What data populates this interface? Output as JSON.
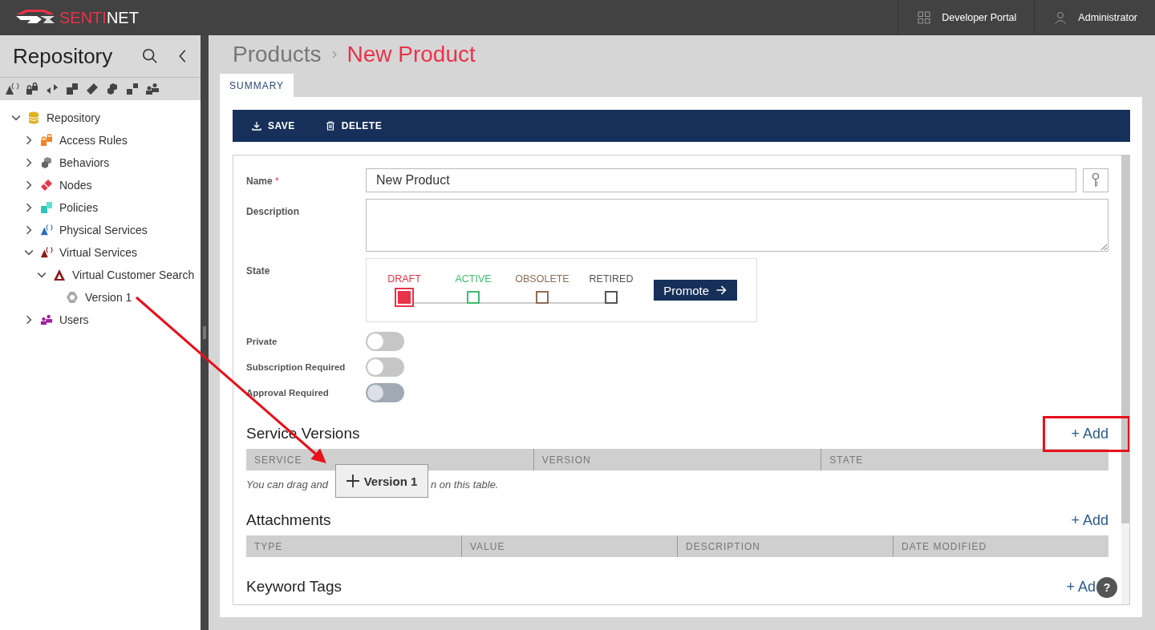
{
  "header": {
    "logo_first": "SENTI",
    "logo_second": "NET",
    "links": [
      {
        "kind": "grid",
        "label": "Developer Portal"
      },
      {
        "kind": "user",
        "label": "Administrator"
      }
    ]
  },
  "sidebar": {
    "title": "Repository",
    "tree": [
      {
        "label": "Repository",
        "kind": "database",
        "expanded": true,
        "children": [
          {
            "label": "Access Rules",
            "kind": "lock",
            "expanded": false
          },
          {
            "label": "Behaviors",
            "kind": "hexagons",
            "expanded": false
          },
          {
            "label": "Nodes",
            "kind": "diamond",
            "expanded": false
          },
          {
            "label": "Policies",
            "kind": "squares",
            "expanded": false
          },
          {
            "label": "Physical Services",
            "kind": "physical",
            "expanded": false
          },
          {
            "label": "Virtual Services",
            "kind": "virtual",
            "expanded": true,
            "children": [
              {
                "label": "Virtual Customer Search",
                "kind": "triangle",
                "expanded": true,
                "children": [
                  {
                    "label": "Version 1",
                    "kind": "gear"
                  }
                ]
              }
            ]
          },
          {
            "label": "Users",
            "kind": "people",
            "expanded": false
          }
        ]
      }
    ]
  },
  "breadcrumb": [
    {
      "label": "Products",
      "selected": false
    },
    {
      "label": "New Product",
      "selected": true
    }
  ],
  "tabs": [
    {
      "label": "SUMMARY",
      "selected": true
    }
  ],
  "toolbar": [
    {
      "kind": "save",
      "label": "SAVE"
    },
    {
      "kind": "delete",
      "label": "DELETE"
    }
  ],
  "form": {
    "name_label": "Name",
    "required_mark": "*",
    "name_value": "New Product",
    "description_label": "Description",
    "state_label": "State",
    "states": [
      {
        "label": "DRAFT",
        "color": "#e8334a",
        "selected": true
      },
      {
        "label": "ACTIVE",
        "color": "#3dbb6c",
        "selected": false
      },
      {
        "label": "OBSOLETE",
        "color": "#8b6d55",
        "selected": false
      },
      {
        "label": "RETIRED",
        "color": "#555555",
        "selected": false
      }
    ],
    "promote": "Promote",
    "toggles": [
      {
        "label": "Private",
        "on": false,
        "disabled": false
      },
      {
        "label": "Subscription Required",
        "on": false,
        "disabled": false
      },
      {
        "label": "Approval Required",
        "on": false,
        "disabled": true
      }
    ]
  },
  "sections": [
    {
      "title": "Service Versions",
      "add": "+ Add",
      "highlighted": true,
      "columns": [
        "SERVICE",
        "VERSION",
        "STATE"
      ],
      "hint_start": "You can drag and",
      "hint_end": "n on this table."
    },
    {
      "title": "Attachments",
      "add": "+ Add",
      "highlighted": false,
      "columns": [
        "TYPE",
        "VALUE",
        "DESCRIPTION",
        "DATE MODIFIED"
      ]
    },
    {
      "title": "Keyword Tags",
      "add": "+ Ad",
      "highlighted": false
    }
  ],
  "drag_ghost": {
    "label": "Version 1"
  },
  "help": "?"
}
